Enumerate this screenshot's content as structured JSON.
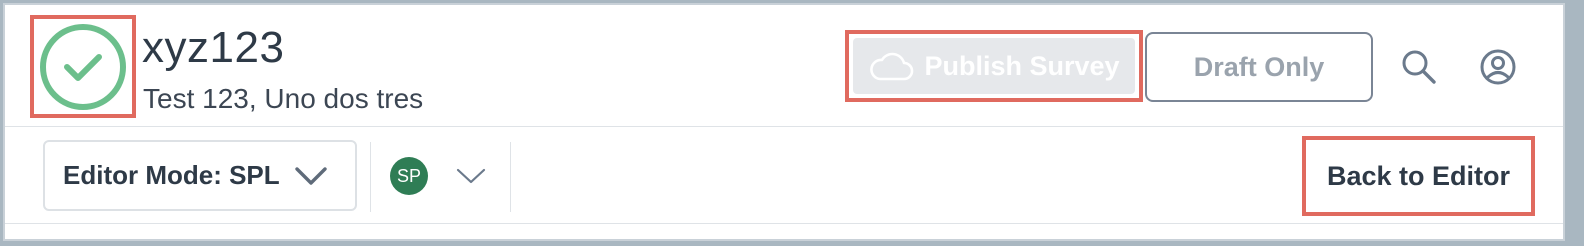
{
  "header": {
    "title": "xyz123",
    "subtitle": "Test 123, Uno dos tres",
    "status_icon": "check-circle-icon",
    "status_color": "#6cbf8c",
    "highlight_color": "#e06a5f"
  },
  "actions": {
    "publish_label": "Publish Survey",
    "publish_icon": "cloud-icon",
    "draft_label": "Draft Only",
    "search_icon": "search-icon",
    "account_icon": "user-circle-icon"
  },
  "toolbar": {
    "editor_mode_label": "Editor Mode: SPL",
    "avatar_initials": "SP",
    "avatar_color": "#2f7d55",
    "back_label": "Back to Editor"
  }
}
